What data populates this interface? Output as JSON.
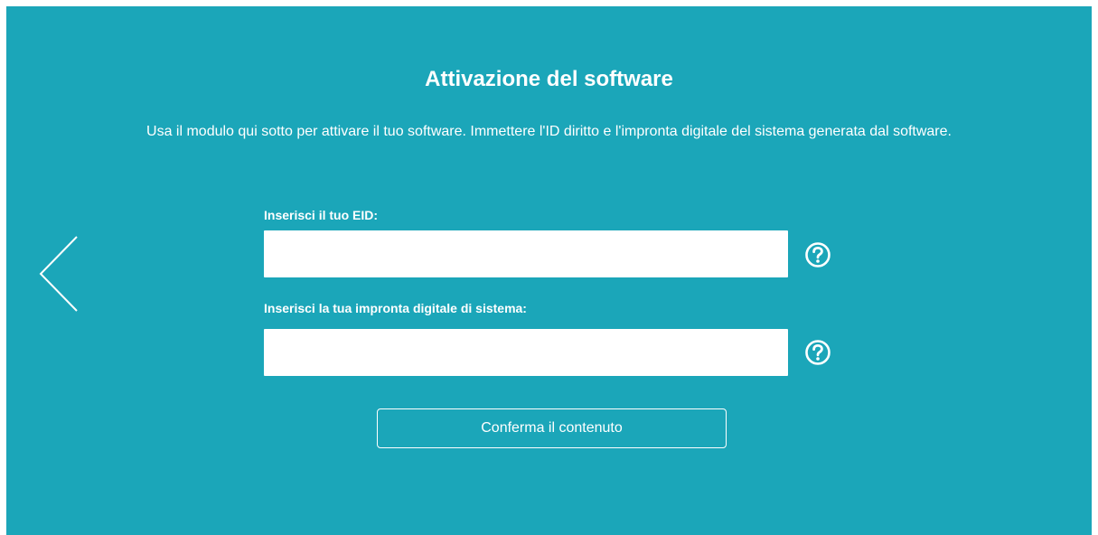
{
  "page": {
    "title": "Attivazione del software",
    "description": "Usa il modulo qui sotto per attivare il tuo software. Immettere l'ID diritto e l'impronta digitale del sistema generata dal software."
  },
  "navigation": {
    "back_icon": "chevron-left-icon"
  },
  "form": {
    "eid": {
      "label": "Inserisci il tuo EID:",
      "value": "",
      "placeholder": "",
      "help_icon": "question-circle-icon"
    },
    "fingerprint": {
      "label": "Inserisci la tua impronta digitale di sistema:",
      "value": "",
      "placeholder": "",
      "help_icon": "question-circle-icon"
    },
    "submit_label": "Conferma il contenuto"
  },
  "colors": {
    "background": "#1ba6b9",
    "text": "#ffffff",
    "input_background": "#ffffff"
  }
}
